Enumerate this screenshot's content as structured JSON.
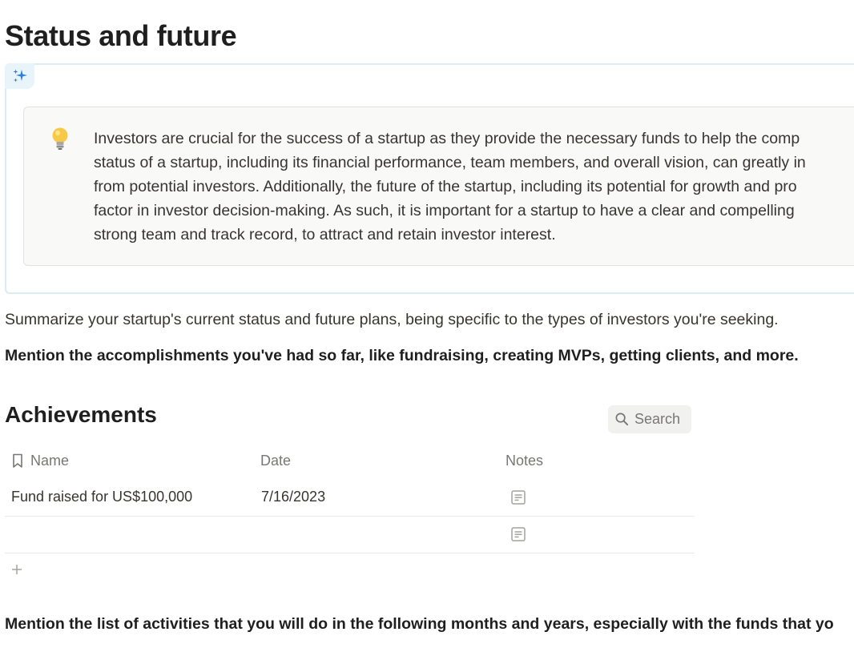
{
  "page": {
    "title": "Status and future"
  },
  "ai_block": {
    "icon": "sparkles-icon",
    "accent_color": "#dcecf6",
    "callout": {
      "icon": "light-bulb-icon",
      "lines": [
        "Investors are crucial for the success of a startup as they provide the necessary funds to help the comp",
        "status of a startup, including its financial performance, team members, and overall vision, can greatly in",
        "from potential investors. Additionally, the future of the startup, including its potential for growth and pro",
        "factor in investor decision-making. As such, it is important for a startup to have a clear and compelling",
        "strong team and track record, to attract and retain investor interest."
      ]
    }
  },
  "body": {
    "paragraph_1": "Summarize your startup's current status and future plans, being specific to the types of investors you're seeking.",
    "paragraph_2": "Mention the accomplishments you've had so far, like fundraising, creating MVPs, getting clients, and more.",
    "paragraph_3": "Mention the list of activities that you will do in the following months and years, especially with the funds that yo"
  },
  "database": {
    "title": "Achievements",
    "search_label": "Search",
    "columns": {
      "name": "Name",
      "date": "Date",
      "notes": "Notes"
    },
    "rows": [
      {
        "name": "Fund raised for US$100,000",
        "date": "7/16/2023"
      },
      {
        "name": "",
        "date": ""
      }
    ]
  }
}
